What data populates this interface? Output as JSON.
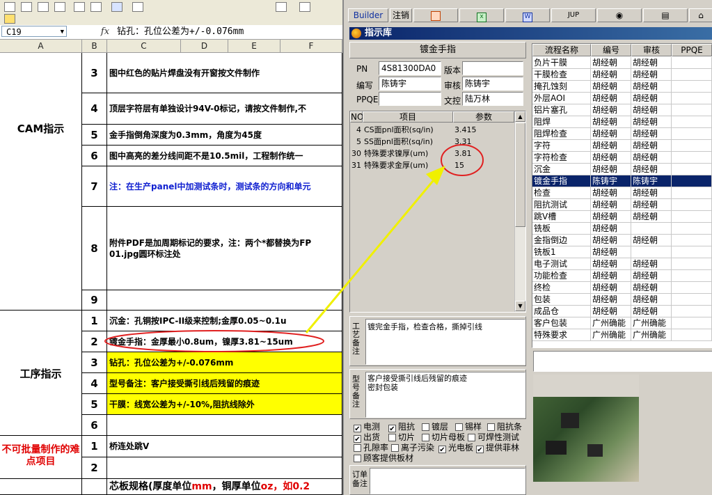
{
  "excel": {
    "name_box": "C19",
    "fx_label": "fx",
    "formula_text": "钻孔：孔位公差为+/-0.076mm",
    "columns": [
      "A",
      "B",
      "C",
      "D",
      "E",
      "F"
    ],
    "section_cam": "CAM指示",
    "section_process": "工序指示",
    "section_hard": "不可批量制作的难点项目",
    "rows": [
      {
        "num": "3",
        "text": "图中红色的贴片焊盘没有开窗按文件制作"
      },
      {
        "num": "4",
        "text": "顶层字符层有单独设计94V-0标记，请按文件制作,不"
      },
      {
        "num": "5",
        "text": "金手指倒角深度为0.3mm，角度为45度"
      },
      {
        "num": "6",
        "text": "图中高亮的差分线间距不是10.5mil，工程制作统一"
      },
      {
        "num": "7",
        "text": "注：在生产panel中加测试条时，测试条的方向和单元"
      },
      {
        "num": "8",
        "line1": "附件PDF是加周期标记的要求，注：两个*都替换为FP",
        "line2": "01.jpg圆环标注处"
      },
      {
        "num": "9",
        "text": ""
      },
      {
        "num": "1",
        "text": "沉金：孔铜按IPC-II级来控制;金厚0.05~0.1u"
      },
      {
        "num": "2",
        "text": "镀金手指：金厚最小0.8um，镍厚3.81~15um"
      },
      {
        "num": "3",
        "text": "钻孔：孔位公差为+/-0.076mm"
      },
      {
        "num": "4",
        "text": "型号备注：客户接受撕引线后残留的痕迹"
      },
      {
        "num": "5",
        "text": "干膜：线宽公差为+/-10%,阻抗线除外"
      },
      {
        "num": "6",
        "text": ""
      },
      {
        "num": "1",
        "text": "桥连处跳V"
      },
      {
        "num": "2",
        "text": ""
      }
    ],
    "bottom_row": {
      "a": "芯板规格(厚度单位",
      "b": "mm",
      "c": "，铜厚单位",
      "d": "oz",
      "e": "，如0.2"
    }
  },
  "app": {
    "toolbar": [
      "Builder",
      "注销",
      "",
      "",
      "",
      "JUP",
      "",
      "",
      ""
    ],
    "window_title": "指示库",
    "item_title": "镀金手指",
    "pn_label": "PN",
    "pn_value": "4S81300DA0",
    "version_label": "版本",
    "version_value": "",
    "writer_label": "编写",
    "writer_value": "陈铸宇",
    "review_label": "审核",
    "review_value": "陈铸宇",
    "ppqe_label": "PPQE",
    "ppqe_value": "",
    "control_label": "文控",
    "control_value": "陆万林",
    "param_headers": [
      "NO",
      "项目",
      "参数"
    ],
    "params": [
      {
        "no": "4",
        "item": "CS面pnl面积(sq/in)",
        "value": "3.415"
      },
      {
        "no": "5",
        "item": "SS面pnl面积(sq/in)",
        "value": "3.31"
      },
      {
        "no": "30",
        "item": "特殊要求镍厚(um)",
        "value": "3.81"
      },
      {
        "no": "31",
        "item": "特殊要求金厚(um)",
        "value": "15"
      }
    ],
    "process_note_label": "工艺备注",
    "process_note": "镀完金手指，检查合格，撕掉引线",
    "model_note_label": "型号备注",
    "model_note_1": "客户接受撕引线后残留的痕迹",
    "model_note_2": "密封包装",
    "checkboxes": [
      {
        "label": "电测",
        "checked": true
      },
      {
        "label": "阻抗",
        "checked": true
      },
      {
        "label": "镀层",
        "checked": false
      },
      {
        "label": "锡样",
        "checked": false
      },
      {
        "label": "阻抗条",
        "checked": false
      },
      {
        "label": "出货",
        "checked": true
      },
      {
        "label": "切片",
        "checked": false
      },
      {
        "label": "切片母板",
        "checked": false
      },
      {
        "label": "可焊性测试",
        "checked": false
      },
      {
        "label": "孔隙率",
        "checked": false
      },
      {
        "label": "离子污染",
        "checked": false
      },
      {
        "label": "光电板",
        "checked": true
      },
      {
        "label": "提供菲林",
        "checked": true
      },
      {
        "label": "顾客提供板材",
        "checked": false
      }
    ],
    "order_note_label": "订单备注",
    "flow_headers": [
      "流程名称",
      "编号",
      "审核",
      "PPQE"
    ],
    "flow_rows": [
      {
        "name": "负片干膜",
        "code": "胡经朝",
        "review": "胡经朝",
        "sel": false
      },
      {
        "name": "干膜检查",
        "code": "胡经朝",
        "review": "胡经朝",
        "sel": false
      },
      {
        "name": "掩孔蚀刻",
        "code": "胡经朝",
        "review": "胡经朝",
        "sel": false
      },
      {
        "name": "外层AOI",
        "code": "胡经朝",
        "review": "胡经朝",
        "sel": false
      },
      {
        "name": "铝片塞孔",
        "code": "胡经朝",
        "review": "胡经朝",
        "sel": false
      },
      {
        "name": "阻焊",
        "code": "胡经朝",
        "review": "胡经朝",
        "sel": false
      },
      {
        "name": "阻焊检查",
        "code": "胡经朝",
        "review": "胡经朝",
        "sel": false
      },
      {
        "name": "字符",
        "code": "胡经朝",
        "review": "胡经朝",
        "sel": false
      },
      {
        "name": "字符检查",
        "code": "胡经朝",
        "review": "胡经朝",
        "sel": false
      },
      {
        "name": "沉金",
        "code": "胡经朝",
        "review": "胡经朝",
        "sel": false
      },
      {
        "name": "镀金手指",
        "code": "陈铸宇",
        "review": "陈铸宇",
        "sel": true
      },
      {
        "name": "检查",
        "code": "胡经朝",
        "review": "胡经朝",
        "sel": false
      },
      {
        "name": "阻抗测试",
        "code": "胡经朝",
        "review": "胡经朝",
        "sel": false
      },
      {
        "name": "跳V槽",
        "code": "胡经朝",
        "review": "胡经朝",
        "sel": false
      },
      {
        "name": "铣板",
        "code": "胡经朝",
        "review": "",
        "sel": false
      },
      {
        "name": "金指倒边",
        "code": "胡经朝",
        "review": "胡经朝",
        "sel": false
      },
      {
        "name": "铣板1",
        "code": "胡经朝",
        "review": "",
        "sel": false
      },
      {
        "name": "电子测试",
        "code": "胡经朝",
        "review": "胡经朝",
        "sel": false
      },
      {
        "name": "功能检查",
        "code": "胡经朝",
        "review": "胡经朝",
        "sel": false
      },
      {
        "name": "终检",
        "code": "胡经朝",
        "review": "胡经朝",
        "sel": false
      },
      {
        "name": "包装",
        "code": "胡经朝",
        "review": "胡经朝",
        "sel": false
      },
      {
        "name": "成品仓",
        "code": "胡经朝",
        "review": "胡经朝",
        "sel": false
      },
      {
        "name": "客户包装",
        "code": "广州确能",
        "review": "广州确能",
        "sel": false
      },
      {
        "name": "特殊要求",
        "code": "广州确能",
        "review": "广州确能",
        "sel": false
      }
    ],
    "colors": {
      "selection": "#0a246a",
      "title_bar": "#0a246a",
      "highlight": "#ffff00",
      "annotation": "#e02020",
      "arrow": "#f0f000"
    }
  }
}
